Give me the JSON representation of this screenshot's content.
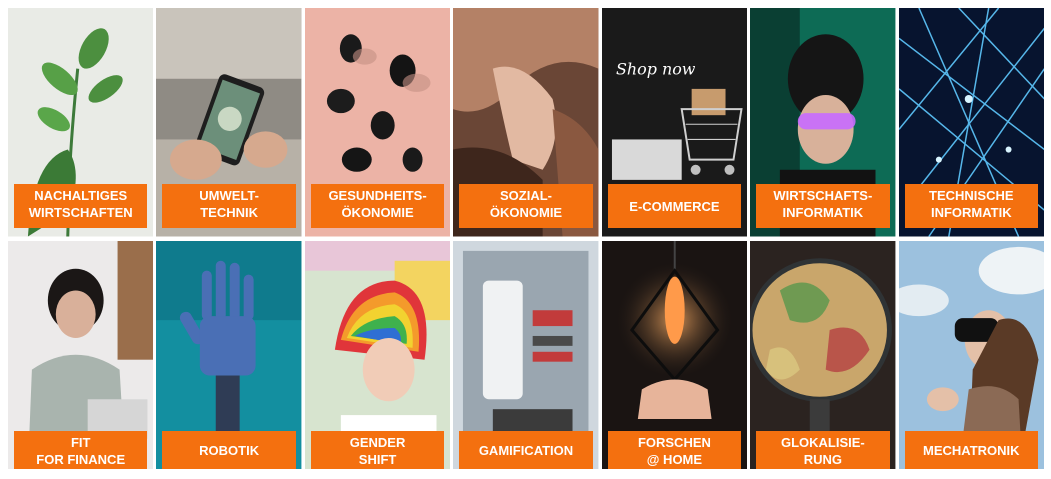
{
  "accent_color": "#f4700f",
  "tiles": [
    {
      "label": "NACHALTIGES\nWIRTSCHAFTEN",
      "icon": "plant-sprout-image"
    },
    {
      "label": "UMWELT-\nTECHNIK",
      "icon": "smartphone-photo-image"
    },
    {
      "label": "GESUNDHEITS-\nÖKONOMIE",
      "icon": "black-stones-image"
    },
    {
      "label": "SOZIAL-\nÖKONOMIE",
      "icon": "holding-hands-image"
    },
    {
      "label": "E-COMMERCE",
      "icon": "shopping-cart-image"
    },
    {
      "label": "WIRTSCHAFTS-\nINFORMATIK",
      "icon": "vr-glasses-woman-image"
    },
    {
      "label": "TECHNISCHE\nINFORMATIK",
      "icon": "network-lines-image"
    },
    {
      "label": "FIT\nFOR FINANCE",
      "icon": "woman-laptop-image"
    },
    {
      "label": "ROBOTIK",
      "icon": "robot-hand-image"
    },
    {
      "label": "GENDER\nSHIFT",
      "icon": "rainbow-hair-image"
    },
    {
      "label": "GAMIFICATION",
      "icon": "pc-hardware-image"
    },
    {
      "label": "FORSCHEN\n@ HOME",
      "icon": "light-bulb-image"
    },
    {
      "label": "GLOKALISIE-\nRUNG",
      "icon": "globe-image"
    },
    {
      "label": "MECHATRONIK",
      "icon": "vr-headset-image"
    }
  ],
  "image_text": {
    "shop_now": "Shop now"
  }
}
